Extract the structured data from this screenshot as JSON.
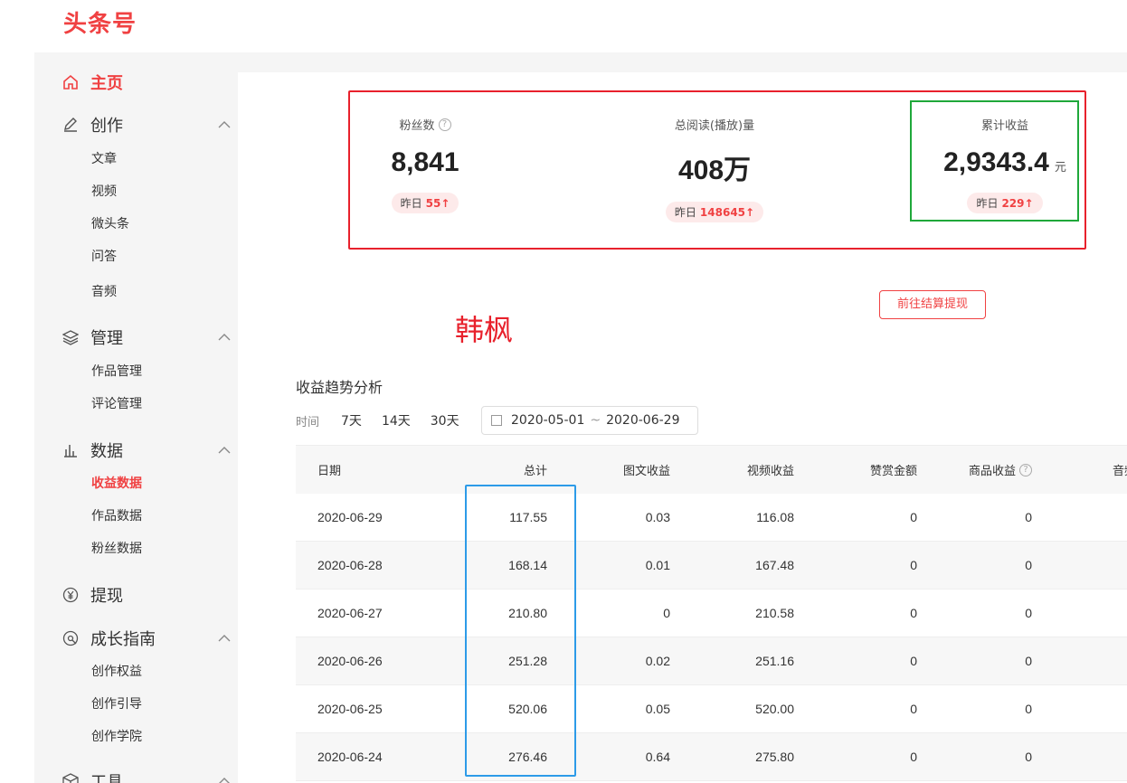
{
  "app": {
    "logo": "头条号"
  },
  "sidebar": {
    "home": "主页",
    "create": {
      "label": "创作",
      "items": [
        "文章",
        "视频",
        "微头条",
        "问答",
        "音频"
      ]
    },
    "manage": {
      "label": "管理",
      "items": [
        "作品管理",
        "评论管理"
      ]
    },
    "data": {
      "label": "数据",
      "items": [
        "收益数据",
        "作品数据",
        "粉丝数据"
      ]
    },
    "withdraw": "提现",
    "growth": {
      "label": "成长指南",
      "items": [
        "创作权益",
        "创作引导",
        "创作学院"
      ]
    },
    "tools": "工具"
  },
  "stats": {
    "fans": {
      "label": "粉丝数",
      "value": "8,841",
      "yesterday_label": "昨日",
      "yesterday_value": "55↑"
    },
    "reads": {
      "label": "总阅读(播放)量",
      "value": "408万",
      "yesterday_label": "昨日",
      "yesterday_value": "148645↑"
    },
    "income": {
      "label": "累计收益",
      "value": "2,9343.4",
      "unit": "元",
      "yesterday_label": "昨日",
      "yesterday_value": "229↑"
    }
  },
  "withdraw_button": "前往结算提现",
  "watermark": "韩枫",
  "trend": {
    "title": "收益趋势分析",
    "time_label": "时间",
    "options": [
      "7天",
      "14天",
      "30天"
    ],
    "date_start": "2020-05-01",
    "date_sep": "~",
    "date_end": "2020-06-29"
  },
  "table": {
    "headers": {
      "date": "日期",
      "total": "总计",
      "tuwen": "图文收益",
      "video": "视频收益",
      "zan": "赞赏金额",
      "shop": "商品收益",
      "more": "音频"
    },
    "rows": [
      {
        "date": "2020-06-29",
        "total": "117.55",
        "tuwen": "0.03",
        "video": "116.08",
        "zan": "0",
        "shop": "0"
      },
      {
        "date": "2020-06-28",
        "total": "168.14",
        "tuwen": "0.01",
        "video": "167.48",
        "zan": "0",
        "shop": "0"
      },
      {
        "date": "2020-06-27",
        "total": "210.80",
        "tuwen": "0",
        "video": "210.58",
        "zan": "0",
        "shop": "0"
      },
      {
        "date": "2020-06-26",
        "total": "251.28",
        "tuwen": "0.02",
        "video": "251.16",
        "zan": "0",
        "shop": "0"
      },
      {
        "date": "2020-06-25",
        "total": "520.06",
        "tuwen": "0.05",
        "video": "520.00",
        "zan": "0",
        "shop": "0"
      },
      {
        "date": "2020-06-24",
        "total": "276.46",
        "tuwen": "0.64",
        "video": "275.80",
        "zan": "0",
        "shop": "0"
      }
    ]
  },
  "colors": {
    "brand": "#f04142",
    "highlight_red": "#e8212c",
    "highlight_green": "#1fa83a",
    "highlight_blue": "#2d9be8"
  }
}
